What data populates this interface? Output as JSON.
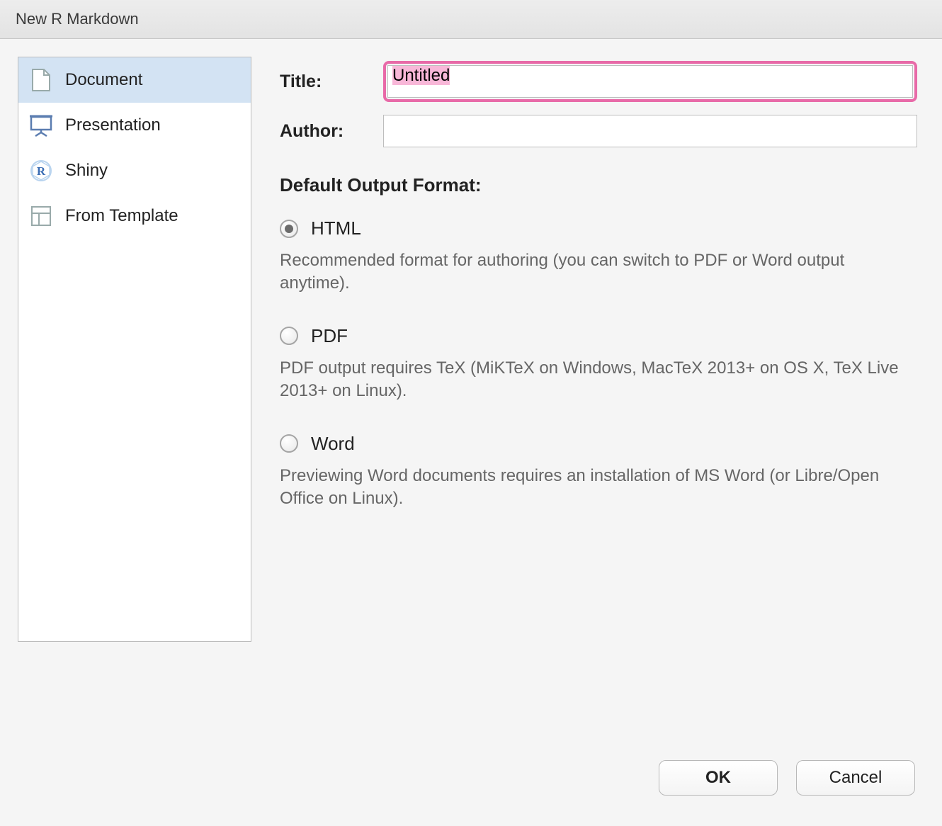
{
  "window": {
    "title": "New R Markdown"
  },
  "sidebar": {
    "items": [
      {
        "label": "Document",
        "selected": true
      },
      {
        "label": "Presentation",
        "selected": false
      },
      {
        "label": "Shiny",
        "selected": false
      },
      {
        "label": "From Template",
        "selected": false
      }
    ]
  },
  "form": {
    "title_label": "Title:",
    "title_value": "Untitled",
    "author_label": "Author:",
    "author_value": ""
  },
  "output": {
    "section_label": "Default Output Format:",
    "options": [
      {
        "label": "HTML",
        "checked": true,
        "description": "Recommended format for authoring (you can switch to PDF or Word output anytime)."
      },
      {
        "label": "PDF",
        "checked": false,
        "description": "PDF output requires TeX (MiKTeX on Windows, MacTeX 2013+ on OS X, TeX Live 2013+ on Linux)."
      },
      {
        "label": "Word",
        "checked": false,
        "description": "Previewing Word documents requires an installation of MS Word (or Libre/Open Office on Linux)."
      }
    ]
  },
  "buttons": {
    "ok": "OK",
    "cancel": "Cancel"
  }
}
